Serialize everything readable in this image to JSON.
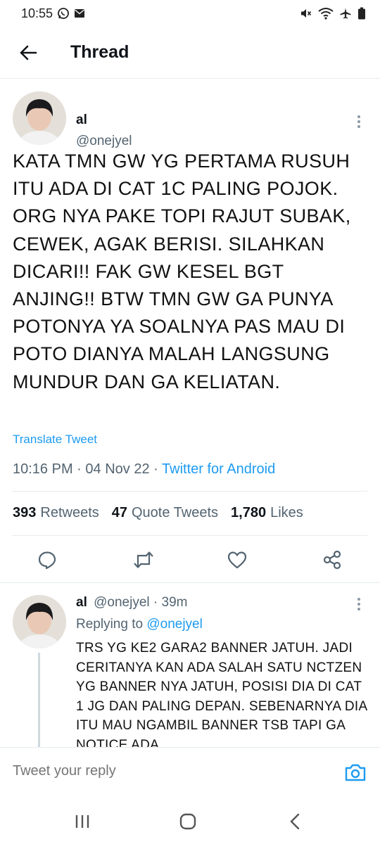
{
  "status_bar": {
    "time": "10:55"
  },
  "header": {
    "title": "Thread"
  },
  "main_tweet": {
    "name": "al",
    "handle": "@onejyel",
    "text": "KATA TMN GW YG PERTAMA RUSUH ITU ADA DI CAT 1C PALING POJOK. ORG NYA PAKE TOPI RAJUT SUBAK, CEWEK, AGAK BERISI. SILAHKAN DICARI!! FAK GW KESEL BGT ANJING!! BTW TMN GW GA PUNYA POTONYA YA SOALNYA PAS MAU DI POTO DIANYA MALAH LANGSUNG MUNDUR DAN GA KELIATAN.",
    "translate_label": "Translate Tweet",
    "time": "10:16 PM",
    "sep": "·",
    "date": "04 Nov 22",
    "source": "Twitter for Android",
    "retweets_count": "393",
    "retweets_label": "Retweets",
    "quotes_count": "47",
    "quotes_label": "Quote Tweets",
    "likes_count": "1,780",
    "likes_label": "Likes"
  },
  "reply_tweet": {
    "name": "al",
    "handle": "@onejyel",
    "sep": "·",
    "age": "39m",
    "replying_label": "Replying to",
    "replying_handle": "@onejyel",
    "text": "TRS YG KE2 GARA2 BANNER JATUH. JADI CERITANYA KAN ADA SALAH SATU NCTZEN YG BANNER NYA JATUH, POSISI DIA DI CAT 1 JG DAN PALING DEPAN. SEBENARNYA DIA ITU MAU NGAMBIL BANNER TSB TAPI GA NOTICE ADA"
  },
  "composer": {
    "placeholder": "Tweet your reply"
  },
  "icons": {
    "back": "arrow-left-icon",
    "more": "more-vertical-icon",
    "reply": "comment-icon",
    "retweet": "retweet-icon",
    "like": "heart-icon",
    "share": "share-icon",
    "camera": "camera-icon"
  },
  "colors": {
    "link": "#1d9bf0",
    "muted": "#536471",
    "text": "#0f1419",
    "divider": "#e6ecf0"
  }
}
